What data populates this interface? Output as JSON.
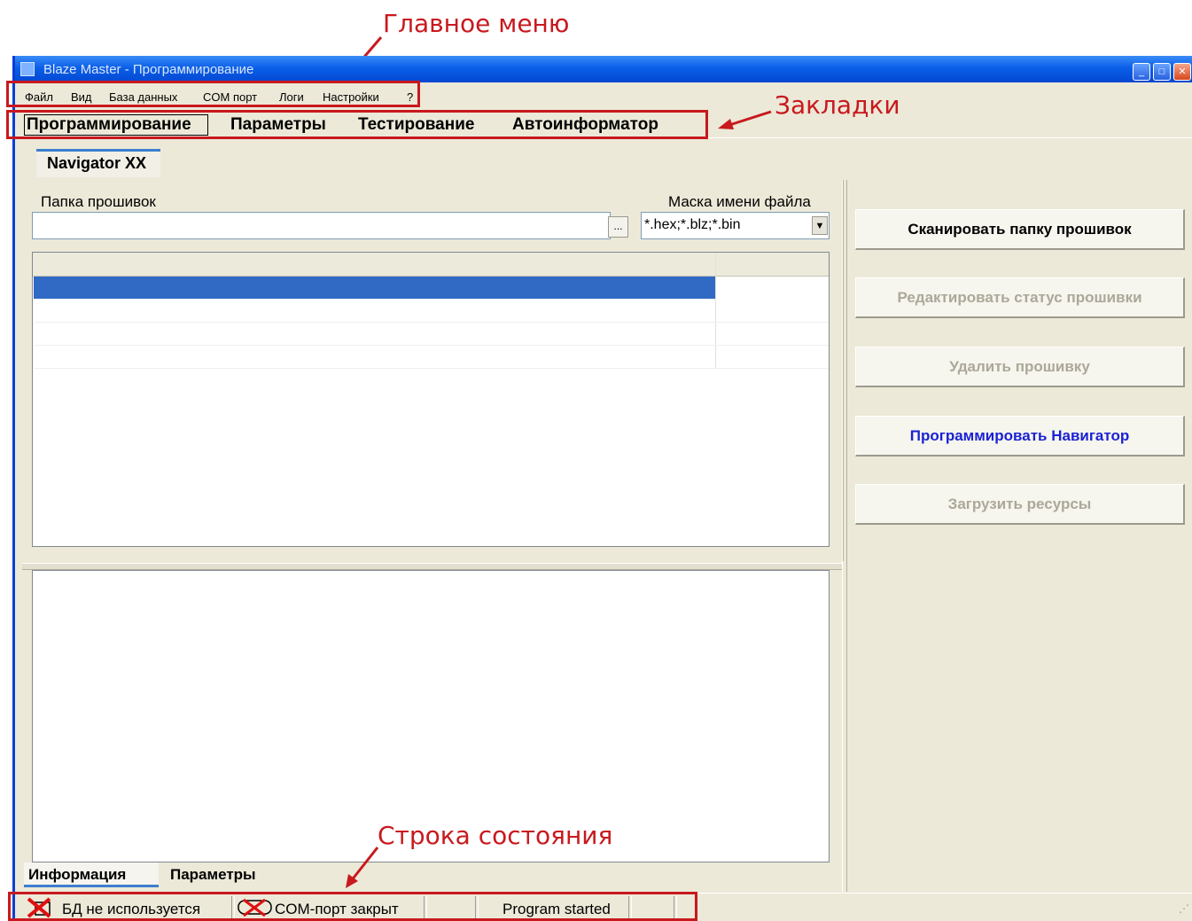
{
  "annotations": {
    "main_menu": "Главное меню",
    "tabs": "Закладки",
    "status_bar": "Строка состояния"
  },
  "window": {
    "title": "Blaze Master - Программирование",
    "title_icon": "app-icon"
  },
  "menu": [
    "Файл",
    "Вид",
    "База данных",
    "COM порт",
    "Логи",
    "Настройки",
    "?"
  ],
  "tabs": [
    "Программирование",
    "Параметры",
    "Тестирование",
    "Автоинформатор"
  ],
  "subtab": "Navigator XX",
  "firmware_folder": {
    "label": "Папка прошивок",
    "value": "",
    "browse_label": "..."
  },
  "file_mask": {
    "label": "Маска имени файла",
    "value": "*.hex;*.blz;*.bin"
  },
  "buttons": {
    "scan": "Сканировать папку прошивок",
    "edit_status": "Редактировать статус прошивки",
    "delete": "Удалить прошивку",
    "program": "Программировать Навигатор",
    "load_resources": "Загрузить ресурсы"
  },
  "bottom_tabs": [
    "Информация",
    "Параметры"
  ],
  "status": {
    "db": "БД не используется",
    "com": "COM-порт закрыт",
    "message": "Program started"
  },
  "colors": {
    "accent": "#c8191e",
    "selection": "#316ac5",
    "titlebar": "#0a5fe8",
    "window_bg": "#ece9d8",
    "program_button": "#1a22d3"
  }
}
